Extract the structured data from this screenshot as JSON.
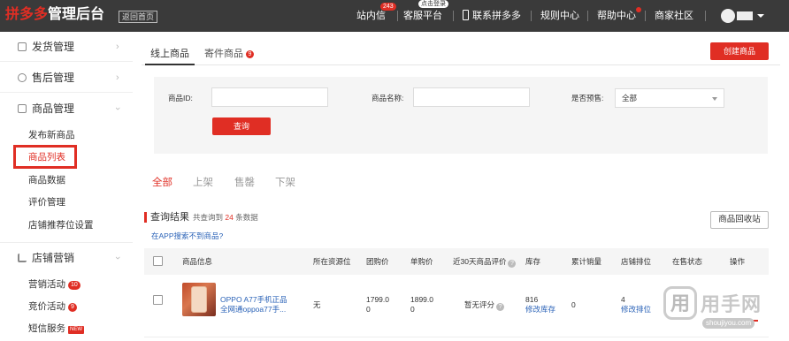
{
  "topbar": {
    "logo_brand": "拼多多",
    "logo_suffix": "管理后台",
    "back_home": "返回首页",
    "nav": [
      "站内信",
      "客服平台",
      "联系拼多多",
      "规则中心",
      "帮助中心",
      "商家社区"
    ],
    "inbox_badge": "243",
    "service_tip": "点击登录"
  },
  "sidebar": {
    "sections": [
      {
        "label": "发货管理",
        "icon": "delivery-icon"
      },
      {
        "label": "售后管理",
        "icon": "aftersale-icon"
      },
      {
        "label": "商品管理",
        "icon": "goods-icon"
      },
      {
        "label": "店铺营销",
        "icon": "marketing-icon"
      }
    ],
    "goods_items": [
      "发布新商品",
      "商品列表",
      "商品数据",
      "评价管理",
      "店铺推荐位设置"
    ],
    "marketing_items": [
      "营销活动",
      "竞价活动",
      "短信服务"
    ],
    "marketing_badges": [
      "10",
      "9",
      "NEW"
    ],
    "active_item": "商品列表"
  },
  "main": {
    "tabs": [
      "线上商品",
      "寄件商品"
    ],
    "tab_badge": "9",
    "create_button": "创建商品",
    "filter": {
      "id_label": "商品ID:",
      "name_label": "商品名称:",
      "presale_label": "是否预售:",
      "presale_value": "全部",
      "query_button": "查询"
    },
    "status_tabs": [
      "全部",
      "上架",
      "售罄",
      "下架"
    ],
    "results": {
      "title": "查询结果",
      "count_prefix": "共查询到",
      "count": "24",
      "count_suffix": "条数据",
      "app_link": "在APP搜索不到商品?",
      "recycle_button": "商品回收站"
    },
    "table": {
      "headers": [
        "商品信息",
        "所在资源位",
        "团购价",
        "单购价",
        "近30天商品评价",
        "库存",
        "累计销量",
        "店铺排位",
        "在售状态",
        "操作"
      ],
      "rows": [
        {
          "name_line1": "OPPO A77手机正品",
          "name_line2": "全网通oppoa77手...",
          "slot": "无",
          "group_price_line1": "1799.0",
          "group_price_line2": "0",
          "single_price_line1": "1899.0",
          "single_price_line2": "0",
          "rating": "暂无评分",
          "stock": "816",
          "stock_action": "修改库存",
          "sales": "0",
          "rank": "4",
          "rank_action": "修改排位"
        }
      ]
    }
  },
  "watermark": {
    "text": "用手网",
    "url": "shoujiyou.com"
  }
}
